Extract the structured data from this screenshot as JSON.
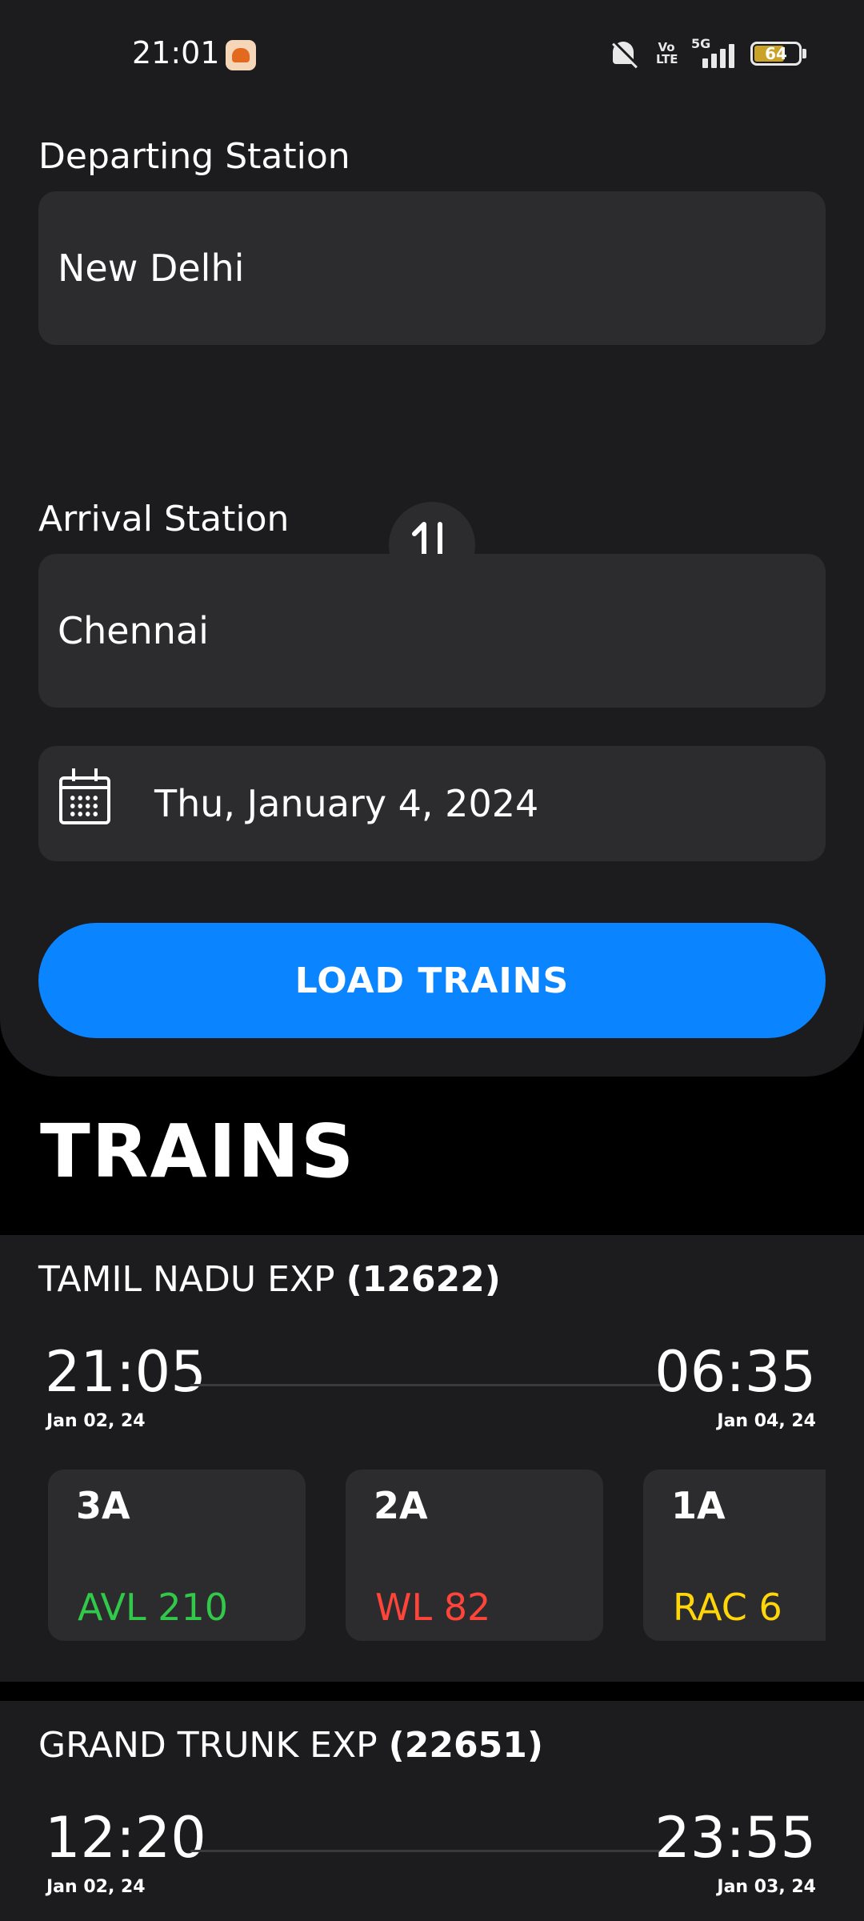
{
  "status_bar": {
    "time": "21:01",
    "network": "5G",
    "volte": "Vo\nLTE",
    "battery": "64"
  },
  "search": {
    "departing_label": "Departing Station",
    "departing_value": "New Delhi",
    "arrival_label": "Arrival Station",
    "arrival_value": "Chennai",
    "date_value": "Thu, January 4, 2024",
    "load_button": "LOAD TRAINS"
  },
  "trains_heading": "TRAINS",
  "trains": [
    {
      "name": "TAMIL NADU EXP ",
      "number": "(12622)",
      "depart_time": "21:05",
      "depart_date": "Jan 02, 24",
      "arrive_time": "06:35",
      "arrive_date": "Jan 04, 24",
      "classes": [
        {
          "name": "3A",
          "status": "AVL 210",
          "color": "#32c94a"
        },
        {
          "name": "2A",
          "status": "WL 82",
          "color": "#ff453a"
        },
        {
          "name": "1A",
          "status": "RAC 6",
          "color": "#ffd60a"
        }
      ]
    },
    {
      "name": "GRAND TRUNK EXP ",
      "number": "(22651)",
      "depart_time": "12:20",
      "depart_date": "Jan 02, 24",
      "arrive_time": "23:55",
      "arrive_date": "Jan 03, 24"
    }
  ],
  "colors": {
    "accent": "#0a84ff",
    "available": "#32c94a",
    "waitlist": "#ff453a",
    "rac": "#ffd60a"
  },
  "icons": [
    "bell-off-icon",
    "signal-icon",
    "battery-icon",
    "swap-icon",
    "calendar-icon"
  ]
}
